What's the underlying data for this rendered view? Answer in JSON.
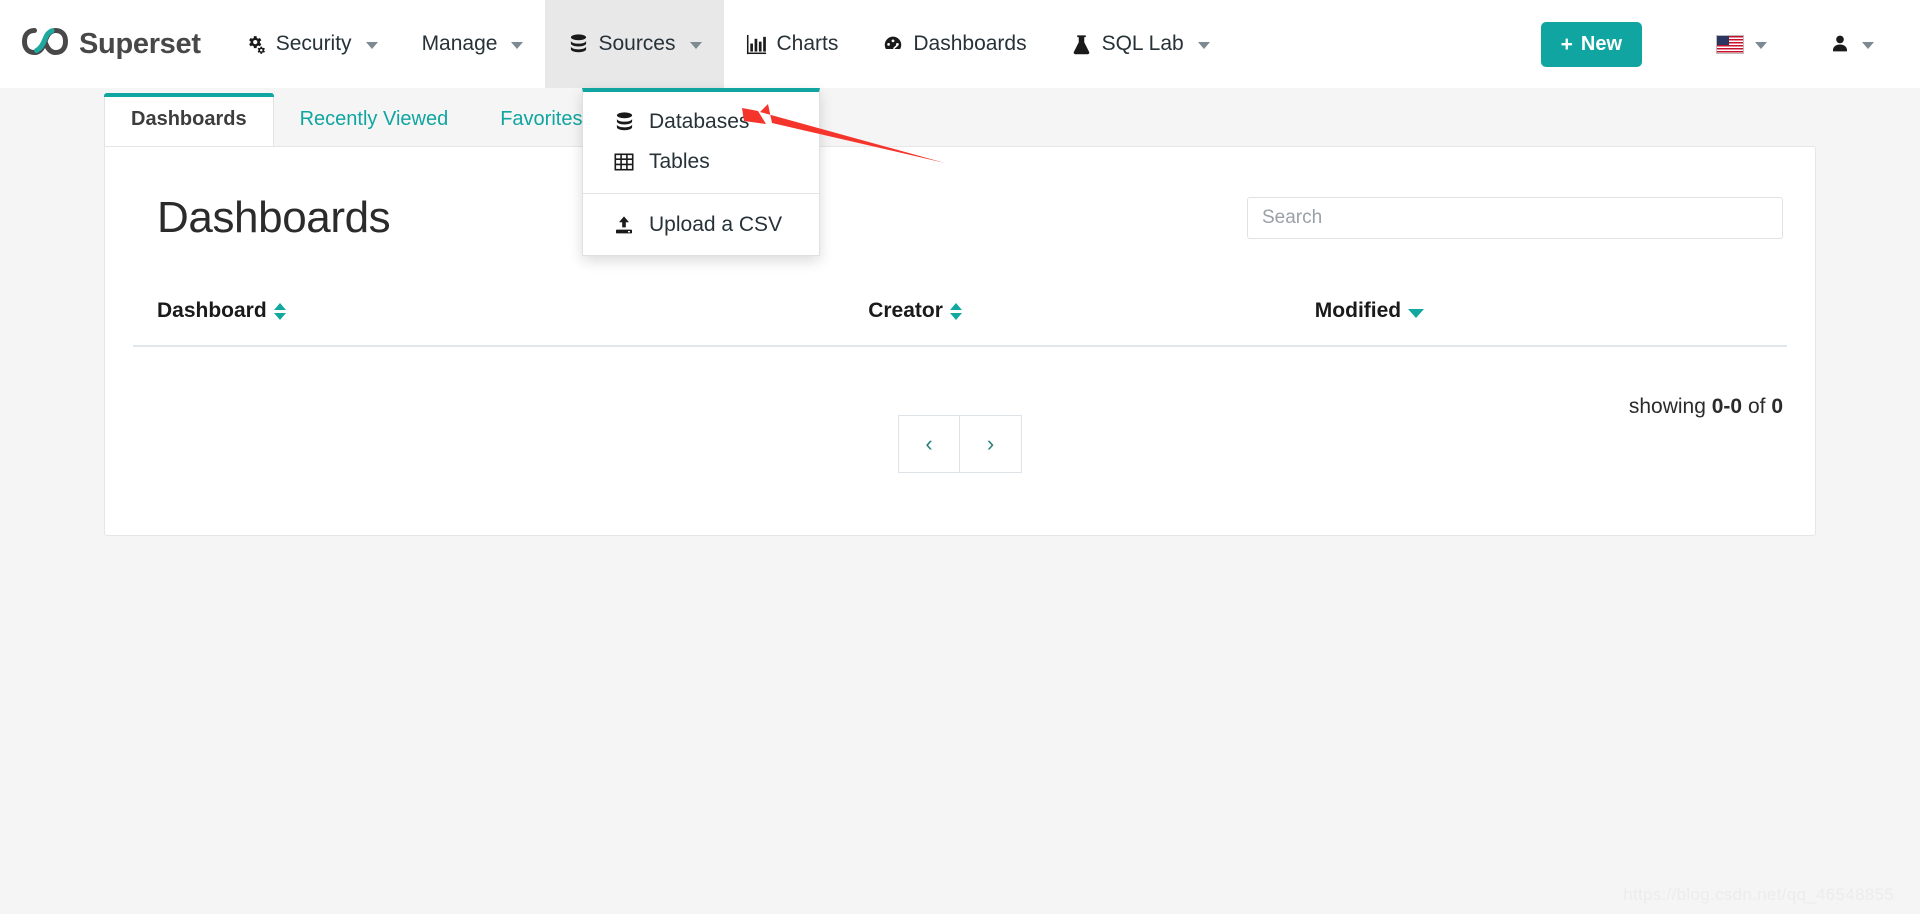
{
  "brand": {
    "name": "Superset",
    "logo_icon": "infinity-logo-icon"
  },
  "navbar": {
    "items": [
      {
        "label": "Security",
        "icon": "gears-icon",
        "has_caret": true,
        "active": false
      },
      {
        "label": "Manage",
        "icon": "",
        "has_caret": true,
        "active": false
      },
      {
        "label": "Sources",
        "icon": "database-icon",
        "has_caret": true,
        "active": true
      },
      {
        "label": "Charts",
        "icon": "bar-chart-icon",
        "has_caret": false,
        "active": false
      },
      {
        "label": "Dashboards",
        "icon": "gauge-icon",
        "has_caret": false,
        "active": false
      },
      {
        "label": "SQL Lab",
        "icon": "flask-icon",
        "has_caret": true,
        "active": false
      }
    ],
    "new_button": {
      "label": "New",
      "plus": "+",
      "color": "#10a5a0"
    },
    "language": {
      "icon": "us-flag-icon",
      "has_caret": true
    },
    "user": {
      "icon": "user-icon",
      "has_caret": true
    }
  },
  "sources_dropdown": {
    "open": true,
    "accent_color": "#10a5a0",
    "groups": [
      {
        "items": [
          {
            "label": "Databases",
            "icon": "database-icon"
          },
          {
            "label": "Tables",
            "icon": "table-grid-icon"
          }
        ]
      },
      {
        "items": [
          {
            "label": "Upload a CSV",
            "icon": "upload-icon"
          }
        ]
      }
    ]
  },
  "tabs": [
    {
      "label": "Dashboards",
      "active": true
    },
    {
      "label": "Recently Viewed",
      "active": false
    },
    {
      "label": "Favorites",
      "active": false
    }
  ],
  "main": {
    "title": "Dashboards",
    "search": {
      "value": "",
      "placeholder": "Search"
    },
    "table": {
      "columns": [
        {
          "label": "Dashboard",
          "sort": "both"
        },
        {
          "label": "Creator",
          "sort": "both"
        },
        {
          "label": "Modified",
          "sort": "desc"
        }
      ],
      "rows": []
    },
    "pagination": {
      "prev_label": "‹",
      "next_label": "›"
    },
    "showing": {
      "prefix": "showing",
      "range": "0-0",
      "middle": "of",
      "total": "0"
    }
  },
  "annotation": {
    "arrow_color": "#f5352b",
    "points_to": "Databases"
  },
  "watermark": {
    "text": "https://blog.csdn.net/qq_46548855"
  }
}
